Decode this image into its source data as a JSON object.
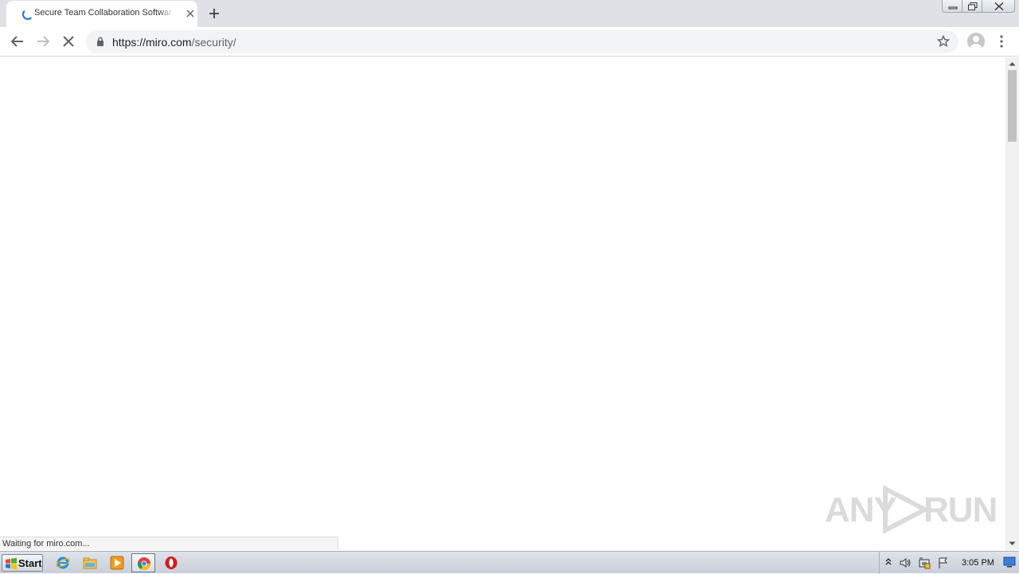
{
  "browser": {
    "tab": {
      "title": "Secure Team Collaboration Software"
    },
    "omnibox": {
      "url_host": "https://miro.com",
      "url_path": "/security/"
    },
    "status_text": "Waiting for miro.com..."
  },
  "watermark": {
    "text_left": "ANY",
    "text_right": "RUN"
  },
  "taskbar": {
    "start_label": "Start",
    "apps": [
      "internet-explorer-icon",
      "file-explorer-icon",
      "media-player-icon",
      "chrome-icon",
      "opera-icon"
    ],
    "clock": "3:05 PM"
  },
  "colors": {
    "tab_strip": "#dee1e6",
    "omnibox": "#f1f3f4",
    "spinner": "#1a73e8",
    "taskbar": "#d3d8e0"
  }
}
